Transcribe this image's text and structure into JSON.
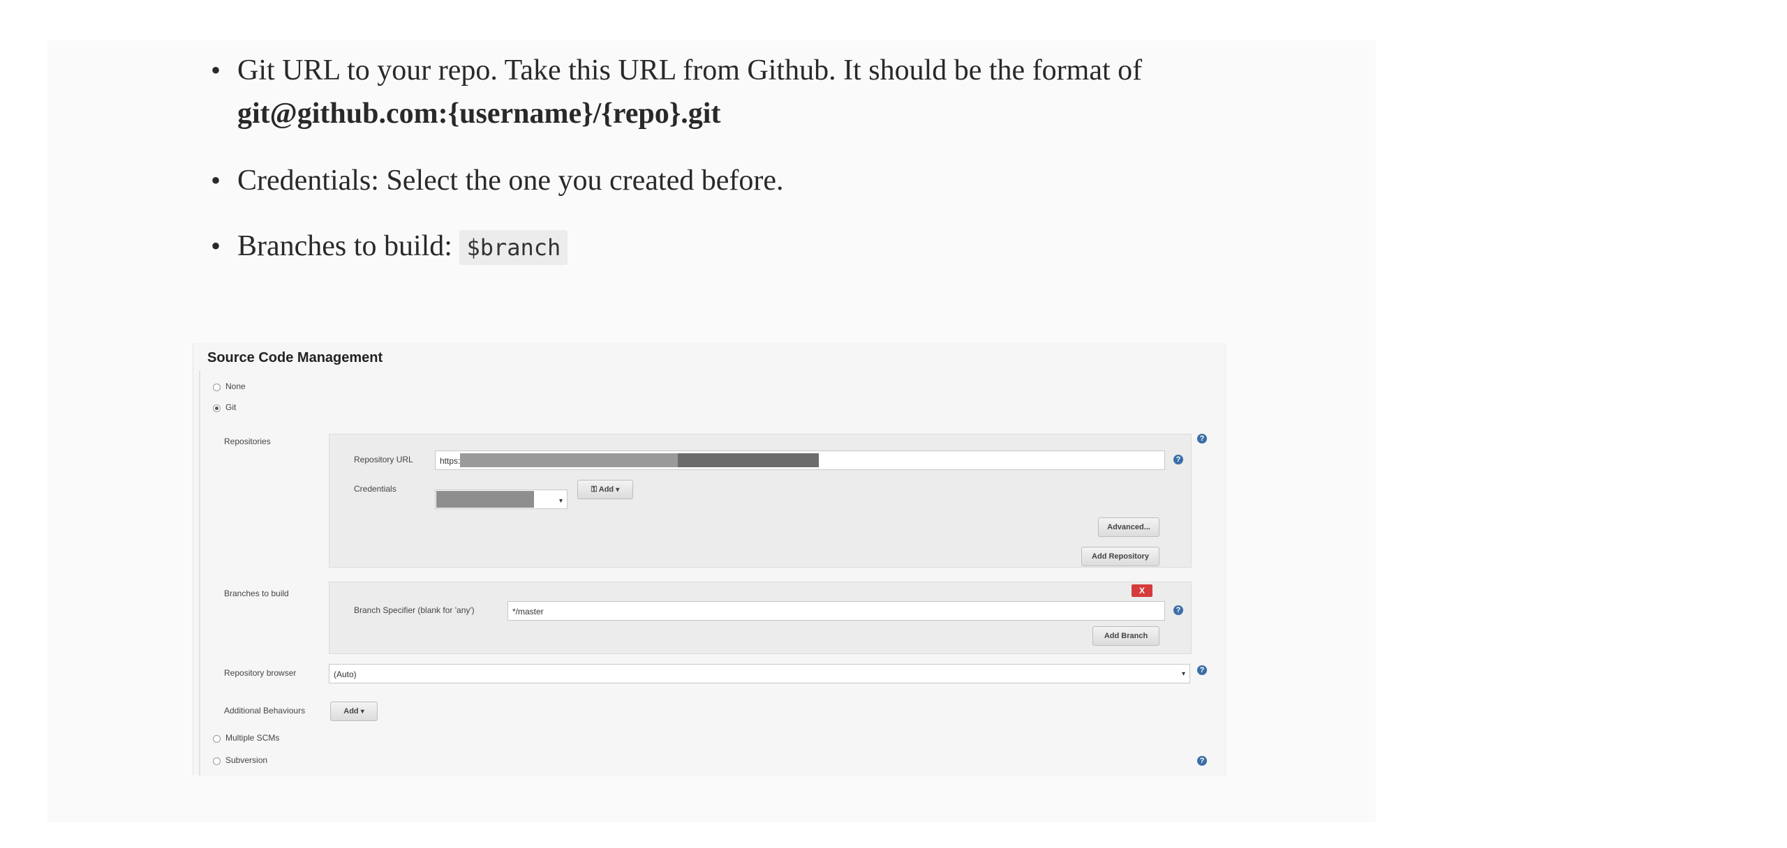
{
  "bullets": [
    {
      "text_before": "Git URL to your repo. Take this URL from Github. It should be the format of ",
      "bold": "git@github.com:{username}/{repo}.git"
    },
    {
      "text": "Credentials: Select the one you created before."
    },
    {
      "text_before": "Branches to build: ",
      "code": "$branch"
    }
  ],
  "scm": {
    "title": "Source Code Management",
    "options": {
      "none": "None",
      "git": "Git",
      "multiple": "Multiple SCMs",
      "subversion": "Subversion"
    },
    "selected": "Git",
    "repositories_label": "Repositories",
    "repo_url_label": "Repository URL",
    "repo_url_value": "https://",
    "credentials_label": "Credentials",
    "add_button": "Add",
    "advanced_button": "Advanced...",
    "add_repository_button": "Add Repository",
    "branches_label": "Branches to build",
    "branch_specifier_label": "Branch Specifier (blank for 'any')",
    "branch_specifier_value": "*/master",
    "delete_label": "X",
    "add_branch_button": "Add Branch",
    "repo_browser_label": "Repository browser",
    "repo_browser_value": "(Auto)",
    "additional_label": "Additional Behaviours",
    "additional_add": "Add",
    "help_glyph": "?"
  },
  "colors": {
    "delete": "#d53b3b",
    "help": "#3a6ea8",
    "card": "#fafafa"
  },
  "icons": {
    "help": "help-icon",
    "dropdown": "caret-down-icon",
    "key": "key-icon"
  }
}
